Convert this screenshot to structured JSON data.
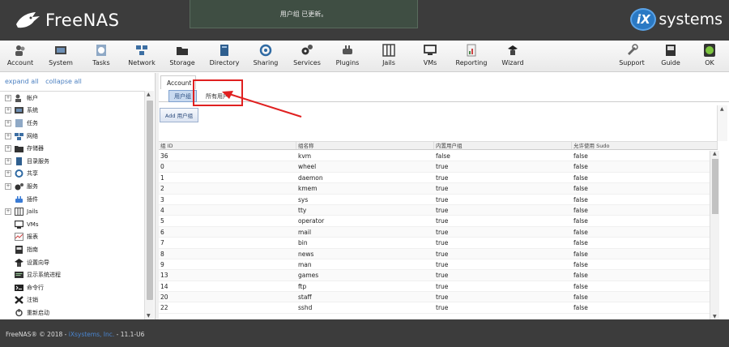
{
  "header": {
    "logo_text": "FreeNAS",
    "toast": "用户组 已更新。",
    "brand_ix": "iX",
    "brand_text": "systems"
  },
  "toolbar": {
    "items": [
      {
        "label": "Account",
        "icon": "account-icon"
      },
      {
        "label": "System",
        "icon": "system-icon"
      },
      {
        "label": "Tasks",
        "icon": "tasks-icon"
      },
      {
        "label": "Network",
        "icon": "network-icon"
      },
      {
        "label": "Storage",
        "icon": "storage-icon"
      },
      {
        "label": "Directory",
        "icon": "directory-icon"
      },
      {
        "label": "Sharing",
        "icon": "sharing-icon"
      },
      {
        "label": "Services",
        "icon": "services-icon"
      },
      {
        "label": "Plugins",
        "icon": "plugins-icon"
      },
      {
        "label": "Jails",
        "icon": "jails-icon"
      },
      {
        "label": "VMs",
        "icon": "vms-icon"
      },
      {
        "label": "Reporting",
        "icon": "reporting-icon"
      },
      {
        "label": "Wizard",
        "icon": "wizard-icon"
      },
      {
        "label": "Support",
        "icon": "support-icon"
      },
      {
        "label": "Guide",
        "icon": "guide-icon"
      },
      {
        "label": "OK",
        "icon": "ok-status-icon"
      }
    ]
  },
  "sidebar": {
    "expand_all": "expand all",
    "collapse_all": "collapse all",
    "items": [
      {
        "label": "帐户",
        "expandable": true
      },
      {
        "label": "系统",
        "expandable": true
      },
      {
        "label": "任务",
        "expandable": true
      },
      {
        "label": "网络",
        "expandable": true
      },
      {
        "label": "存储器",
        "expandable": true
      },
      {
        "label": "目录服务",
        "expandable": true
      },
      {
        "label": "共享",
        "expandable": true
      },
      {
        "label": "服务",
        "expandable": true
      },
      {
        "label": "插件",
        "expandable": false
      },
      {
        "label": "Jails",
        "expandable": true
      },
      {
        "label": "VMs",
        "expandable": false
      },
      {
        "label": "报表",
        "expandable": false
      },
      {
        "label": "指南",
        "expandable": false
      },
      {
        "label": "设置向导",
        "expandable": false
      },
      {
        "label": "显示系统进程",
        "expandable": false
      },
      {
        "label": "命令行",
        "expandable": false
      },
      {
        "label": "注销",
        "expandable": false
      },
      {
        "label": "重新启动",
        "expandable": false
      }
    ]
  },
  "main": {
    "tab": "Account",
    "subtabs": {
      "active": "用户组",
      "other": "所有用户"
    },
    "add_button": "Add 用户组",
    "columns": [
      "组 ID",
      "组名称",
      "内置用户组",
      "允许使用 Sudo"
    ],
    "rows": [
      [
        "36",
        "kvm",
        "false",
        "false"
      ],
      [
        "0",
        "wheel",
        "true",
        "false"
      ],
      [
        "1",
        "daemon",
        "true",
        "false"
      ],
      [
        "2",
        "kmem",
        "true",
        "false"
      ],
      [
        "3",
        "sys",
        "true",
        "false"
      ],
      [
        "4",
        "tty",
        "true",
        "false"
      ],
      [
        "5",
        "operator",
        "true",
        "false"
      ],
      [
        "6",
        "mail",
        "true",
        "false"
      ],
      [
        "7",
        "bin",
        "true",
        "false"
      ],
      [
        "8",
        "news",
        "true",
        "false"
      ],
      [
        "9",
        "man",
        "true",
        "false"
      ],
      [
        "13",
        "games",
        "true",
        "false"
      ],
      [
        "14",
        "ftp",
        "true",
        "false"
      ],
      [
        "20",
        "staff",
        "true",
        "false"
      ],
      [
        "22",
        "sshd",
        "true",
        "false"
      ]
    ]
  },
  "footer": {
    "prefix": "FreeNAS® © 2018 - ",
    "company": "iXsystems, Inc.",
    "version": " - 11.1-U6"
  },
  "colors": {
    "header_bg": "#3c3c3c",
    "link": "#4a7fc1",
    "annotation_red": "#e02020"
  }
}
